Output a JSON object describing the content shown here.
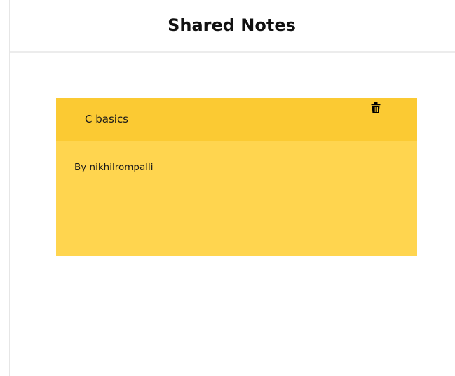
{
  "header": {
    "title": "Shared Notes"
  },
  "notes": [
    {
      "title": "C basics",
      "author_line": "By nikhilrompalli",
      "delete_icon": "trash-icon"
    }
  ],
  "colors": {
    "note_body": "#ffd54f",
    "note_header": "#fbca33"
  }
}
